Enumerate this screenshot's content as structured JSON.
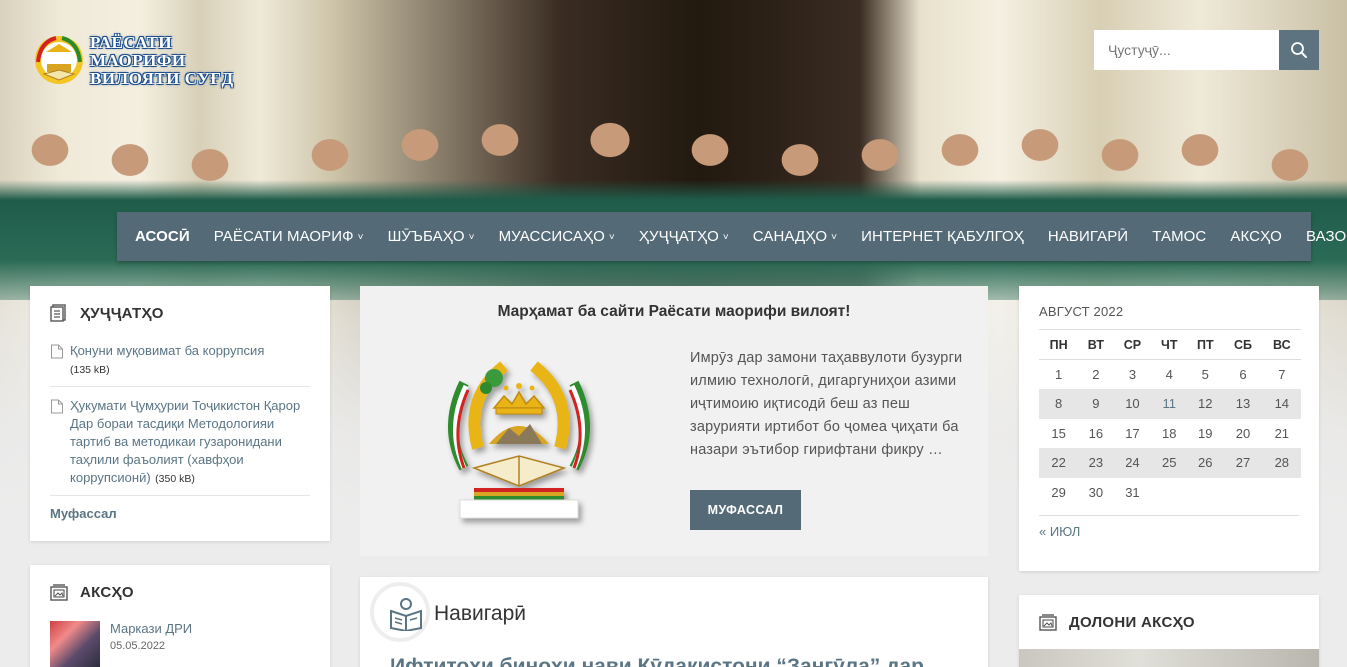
{
  "site": {
    "logo_lines": [
      "РАЁСАТИ",
      "МАОРИФИ",
      "ВИЛОЯТИ СУҒД"
    ]
  },
  "search": {
    "placeholder": "Ҷустуҷӯ..."
  },
  "nav": {
    "items": [
      {
        "label": "АСОСӢ",
        "active": true,
        "dropdown": false
      },
      {
        "label": "РАЁСАТИ МАОРИФ",
        "dropdown": true
      },
      {
        "label": "ШӮЪБАҲО",
        "dropdown": true
      },
      {
        "label": "МУАССИСАҲО",
        "dropdown": true
      },
      {
        "label": "ҲУҶҶАТҲО",
        "dropdown": true
      },
      {
        "label": "САНАДҲО",
        "dropdown": true
      },
      {
        "label": "ИНТЕРНЕТ ҚАБУЛГОҲ",
        "dropdown": false
      },
      {
        "label": "НАВИГАРӢ",
        "dropdown": false
      },
      {
        "label": "ТАМОС",
        "dropdown": false
      },
      {
        "label": "АКСҲО",
        "dropdown": false
      },
      {
        "label": "ВАЗОРАТ",
        "dropdown": false
      }
    ]
  },
  "docs_widget": {
    "title": "ҲУҶҶАТҲО",
    "items": [
      {
        "title": "Қонуни муқовимат ба коррупсия",
        "size": "(135 kB)"
      },
      {
        "title": "Ҳукумати Ҷумҳурии Тоҷикистон Қарор Дар бораи тасдиқи Методологияи тартиб ва методикаи гузаронидани таҳлили фаъолият (хавфҳои коррупсионӣ)",
        "size": "(350 kB)"
      }
    ],
    "more": "Муфассал"
  },
  "photos_widget": {
    "title": "АКСҲО",
    "items": [
      {
        "title": "Маркази ДРИ",
        "date": "05.05.2022"
      }
    ]
  },
  "welcome": {
    "title": "Марҳамат ба сайти Раёсати маорифи вилоят!",
    "text": "Имрӯз дар замони таҳаввулоти бузурги илмию технологӣ, дигаргуниҳои азими иҷтимоию иқтисодӣ беш аз пеш зарурияти иртибот бо ҷомеа ҷиҳати ба назари эътибор гирифтани фикру …",
    "button": "МУФАССАЛ"
  },
  "news": {
    "title": "Навигарӣ",
    "headline": "Ифтитоҳи биноҳи нави Кӯдакистони “Зангӯла” дар"
  },
  "calendar": {
    "caption": "АВГУСТ 2022",
    "weekdays": [
      "ПН",
      "ВТ",
      "СР",
      "ЧТ",
      "ПТ",
      "СБ",
      "ВС"
    ],
    "weeks": [
      [
        "1",
        "2",
        "3",
        "4",
        "5",
        "6",
        "7"
      ],
      [
        "8",
        "9",
        "10",
        "11",
        "12",
        "13",
        "14"
      ],
      [
        "15",
        "16",
        "17",
        "18",
        "19",
        "20",
        "21"
      ],
      [
        "22",
        "23",
        "24",
        "25",
        "26",
        "27",
        "28"
      ],
      [
        "29",
        "30",
        "31",
        "",
        "",
        "",
        ""
      ]
    ],
    "linked_days": [
      "11"
    ],
    "prev": "« ИЮЛ"
  },
  "albums_widget": {
    "title": "ДОЛОНИ АКСҲО"
  },
  "colors": {
    "nav_bg": "#546a77",
    "link": "#5b7584",
    "page_bg": "#e9e9e9"
  }
}
